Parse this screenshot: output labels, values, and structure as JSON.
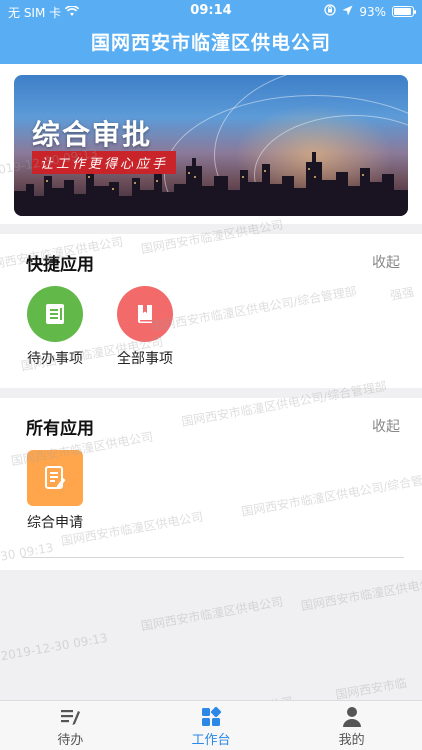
{
  "status_bar": {
    "carrier": "无 SIM 卡",
    "time": "09:14",
    "battery": "93%"
  },
  "header": {
    "title": "国网西安市临潼区供电公司"
  },
  "banner": {
    "title": "综合审批",
    "slogan": "让工作更得心应手"
  },
  "quick_apps": {
    "title": "快捷应用",
    "collapse": "收起",
    "items": [
      {
        "label": "待办事项",
        "icon": "todo-list-icon"
      },
      {
        "label": "全部事项",
        "icon": "book-icon"
      }
    ]
  },
  "all_apps": {
    "title": "所有应用",
    "collapse": "收起",
    "items": [
      {
        "label": "综合申请",
        "icon": "form-edit-icon"
      }
    ]
  },
  "watermark": {
    "line1": "国网西安市临潼区供电公司/综合管理部",
    "line2": "国网西安市临潼区供电公司",
    "line3": "2019-12-30 09:13",
    "line4": "国网西安市临",
    "line5": "强强",
    "line6": "30 09:13"
  },
  "tab_bar": {
    "active": "workbench",
    "tabs": [
      {
        "id": "todo",
        "label": "待办"
      },
      {
        "id": "workbench",
        "label": "工作台"
      },
      {
        "id": "mine",
        "label": "我的"
      }
    ]
  },
  "colors": {
    "primary": "#59aef3",
    "active_tab": "#2b88e6",
    "green_icon": "#62b94a",
    "red_icon": "#f26a6a",
    "orange_icon": "#ffa64d"
  }
}
